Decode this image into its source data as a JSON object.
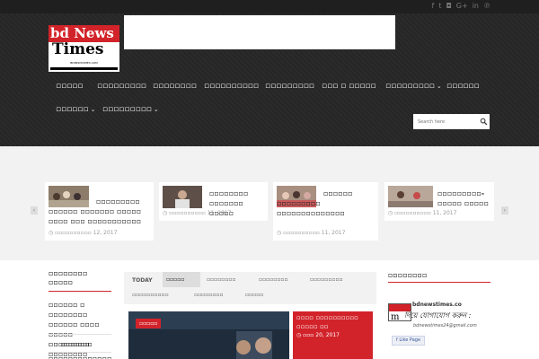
{
  "social_icons": [
    "facebook-icon",
    "twitter-icon",
    "instagram-icon",
    "google-plus-icon",
    "linkedin-icon",
    "pinterest-icon"
  ],
  "logo": {
    "line1": "bd News",
    "line2": "Times",
    "tagline": "BDNEWSTIMES.COM"
  },
  "nav": {
    "row1": [
      "▫▫▫▫▫",
      "▫▫▫▫▫▫▫▫▫",
      "▫▫▫▫▫▫▫▫",
      "▫▫▫▫▫▫▫▫▫▫",
      "▫▫▫▫▫▫▫▫▫",
      "▫▫▫ ▫ ▫▫▫▫▫",
      "▫▫▫▫▫▫▫▫▫",
      "▫▫▫▫▫▫"
    ],
    "row2": [
      "▫▫▫▫▫▫",
      "▫▫▫▫▫▫▫▫▫"
    ]
  },
  "search": {
    "placeholder": "Search here"
  },
  "carousel": [
    {
      "title": "▫▫▫▫▫▫▫▫▫ ▫▫▫▫▫▫ ▫▫▫▫▫▫▫ ▫▫▫▫▫ ▫▫▫▫ ▫▫▫ ▫▫▫▫▫▫▫▫▫▫▫",
      "date": "▫▫▫▫▫▫▫▫▫▫ 12, 2017"
    },
    {
      "title": "▫▫▫▫▫▫▫▫ ▫▫▫▫▫▫▫ ▫▫▫▫▫",
      "date": "▫▫▫▫▫▫▫▫▫▫ 11, 2017"
    },
    {
      "title": "▫▫▫▫▫▫ ▫▫▫▫▫▫▫▫▫ ▫▫▫▫▫▫▫▫▫▫▫▫▫▫",
      "date": "▫▫▫▫▫▫▫▫▫▫ 11, 2017"
    },
    {
      "title": "▫▫▫▫▫▫▫▫▫-▫▫▫▫▫ ▫▫▫▫▫",
      "date": "▫▫▫▫▫▫▫▫▫▫ 11, 2017"
    }
  ],
  "sidebar": {
    "title": "▫▫▫▫▫▫▫▫ ▫▫▫▫▫",
    "items": [
      "▫▫▫▫▫▫ ▫ ▫▫▫▫▫▫▫▫ ▫▫▫▫▫▫ ▫▫▫▫ ▫▫▫▫▫ ▫▫▫▫▫▫▫▫▫ ▫▫▫▫▫▫▫▫",
      "▫▫ ▫▫▫▫▫▫",
      "▫▫▫▫▫▫▫▫▫▫▫▫▫"
    ]
  },
  "tabs": {
    "today": "TODAY",
    "items": [
      "▫▫▫▫▫",
      "▫▫▫▫▫▫▫▫",
      "▫▫▫▫▫▫▫▫",
      "▫▫▫▫▫▫▫▫▫",
      "▫▫▫▫▫▫▫▫▫▫",
      "▫▫▫▫▫▫▫▫",
      "▫▫▫▫▫"
    ]
  },
  "feature": {
    "badge": "▫▫▫▫▫"
  },
  "featured_post": {
    "title": "▫▫▫▫ ▫▫▫▫▫▫▫▫▫▫ ▫▫▫▫▫ ▫▫",
    "date": "▫▫▫ 20, 2017"
  },
  "right": {
    "title": "▫▫▫▫▫▫▫▫",
    "fb_url": "bdnewstimes.co",
    "fb_line": "দিয়ে যোগাযোগ করুন :",
    "fb_email": "bdnewstimes24@gmail.com",
    "like": "Like Page"
  },
  "colors": {
    "accent": "#d2232a",
    "header_bg": "#2b2b2b",
    "topbar": "#1f1f1f"
  }
}
